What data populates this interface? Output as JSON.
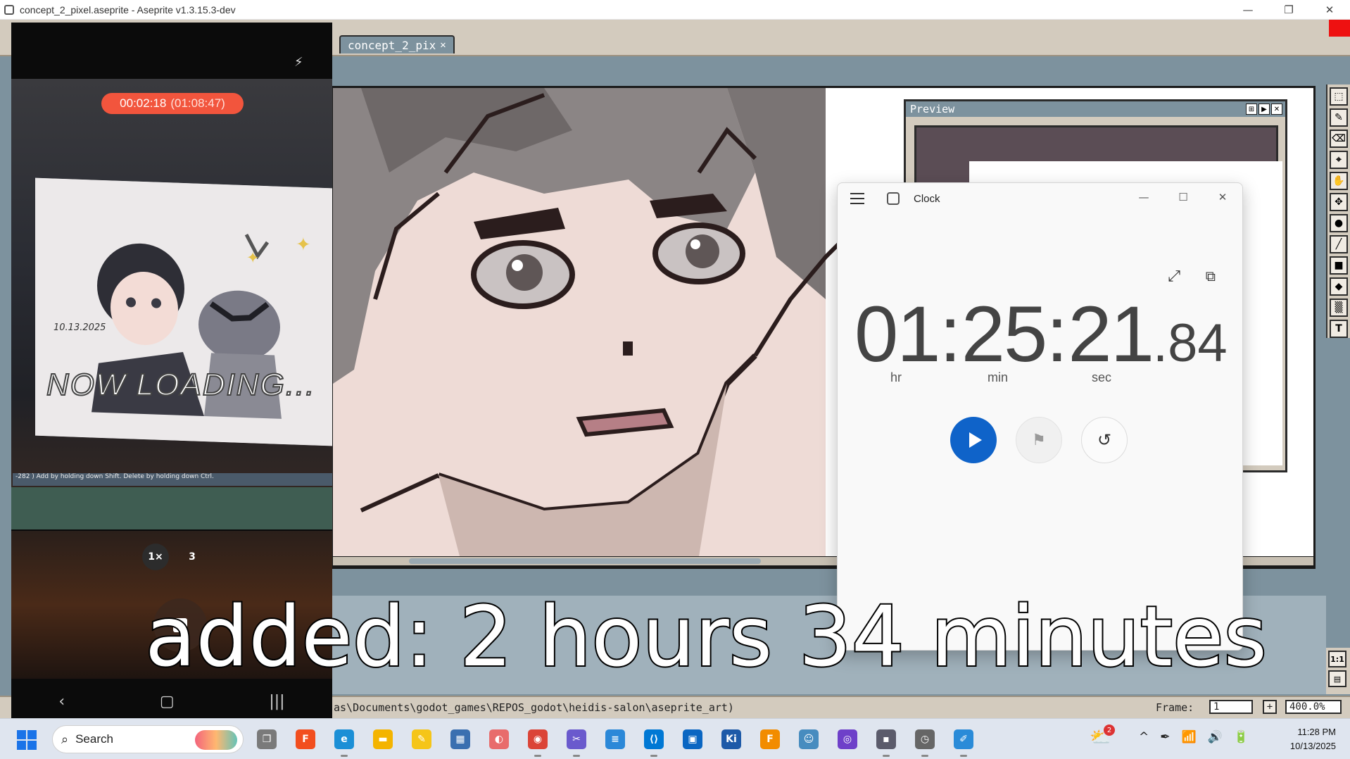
{
  "window": {
    "title": "concept_2_pixel.aseprite - Aseprite v1.3.15.3-dev",
    "controls": [
      "—",
      "❐",
      "✕"
    ]
  },
  "aseprite": {
    "tab_label": "concept_2_pix",
    "tab_close": "✕",
    "preview_title": "Preview",
    "status_path": "as\\Documents\\godot_games\\REPOS_godot\\heidis-salon\\aseprite_art)",
    "frame_label": "Frame:",
    "frame_value": "1",
    "zoom_value": "400.0%",
    "add_frame": "+",
    "right_tools": [
      "⬚",
      "✎",
      "⌫",
      "⌖",
      "✋",
      "✥",
      "●",
      "╱",
      "■",
      "◆",
      "▒",
      "T"
    ],
    "bottom_tools": [
      "1:1",
      "▤"
    ]
  },
  "phone": {
    "rec_elapsed": "00:02:18",
    "rec_total": "(01:08:47)",
    "flash_icon": "⚡",
    "art_caption": "NOW LOADING...",
    "art_signature": "10.13.2025",
    "desk_status": "-282 )   Add by holding down Shift. Delete by holding down Ctrl.",
    "zoom_1x": "1×",
    "zoom_3": "3",
    "nav_back": "‹",
    "nav_home": "▢",
    "nav_recents": "|||"
  },
  "clock_app": {
    "name": "Clock",
    "hours": "01",
    "minutes": "25",
    "seconds": "21",
    "hundredths": ".84",
    "label_hr": "hr",
    "label_min": "min",
    "label_sec": "sec",
    "expand_icon": "⤢",
    "compact_icon": "⧉",
    "lap_icon": "⚑",
    "reset_icon": "↺",
    "controls": [
      "—",
      "☐",
      "✕"
    ],
    "accent": "#0f63c9"
  },
  "caption": "added: 2 hours 34 minutes",
  "taskbar": {
    "search_placeholder": "Search",
    "apps": [
      {
        "name": "task-view",
        "glyph": "❐",
        "color": "#7a7a7a"
      },
      {
        "name": "figma",
        "glyph": "F",
        "color": "#f24e1e"
      },
      {
        "name": "edge",
        "glyph": "e",
        "color": "#1b8fd6"
      },
      {
        "name": "file-explorer",
        "glyph": "▬",
        "color": "#f4b400"
      },
      {
        "name": "sticky-notes",
        "glyph": "✎",
        "color": "#f5c518"
      },
      {
        "name": "calculator",
        "glyph": "▦",
        "color": "#3a6fb0"
      },
      {
        "name": "photos",
        "glyph": "◐",
        "color": "#e86c6c"
      },
      {
        "name": "chrome",
        "glyph": "◉",
        "color": "#db4437"
      },
      {
        "name": "snipping-tool",
        "glyph": "✂",
        "color": "#6a5acd"
      },
      {
        "name": "notepad",
        "glyph": "≡",
        "color": "#2b88d8"
      },
      {
        "name": "vscode",
        "glyph": "⟨⟩",
        "color": "#0078d4"
      },
      {
        "name": "store",
        "glyph": "▣",
        "color": "#0a66c2"
      },
      {
        "name": "krita",
        "glyph": "Ki",
        "color": "#1e5aa8"
      },
      {
        "name": "fl-studio",
        "glyph": "F",
        "color": "#f28c00"
      },
      {
        "name": "godot",
        "glyph": "☺",
        "color": "#478cbf"
      },
      {
        "name": "github-desktop",
        "glyph": "◎",
        "color": "#6e40c9"
      },
      {
        "name": "aseprite",
        "glyph": "▪",
        "color": "#5b5b6b"
      },
      {
        "name": "clock",
        "glyph": "◷",
        "color": "#666666"
      },
      {
        "name": "paint",
        "glyph": "✐",
        "color": "#2a8bd8"
      }
    ],
    "weather_badge": "2",
    "time": "11:28 PM",
    "date": "10/13/2025",
    "tray_icons": [
      "^",
      "✒",
      "📶",
      "🔊",
      "🔋"
    ]
  }
}
